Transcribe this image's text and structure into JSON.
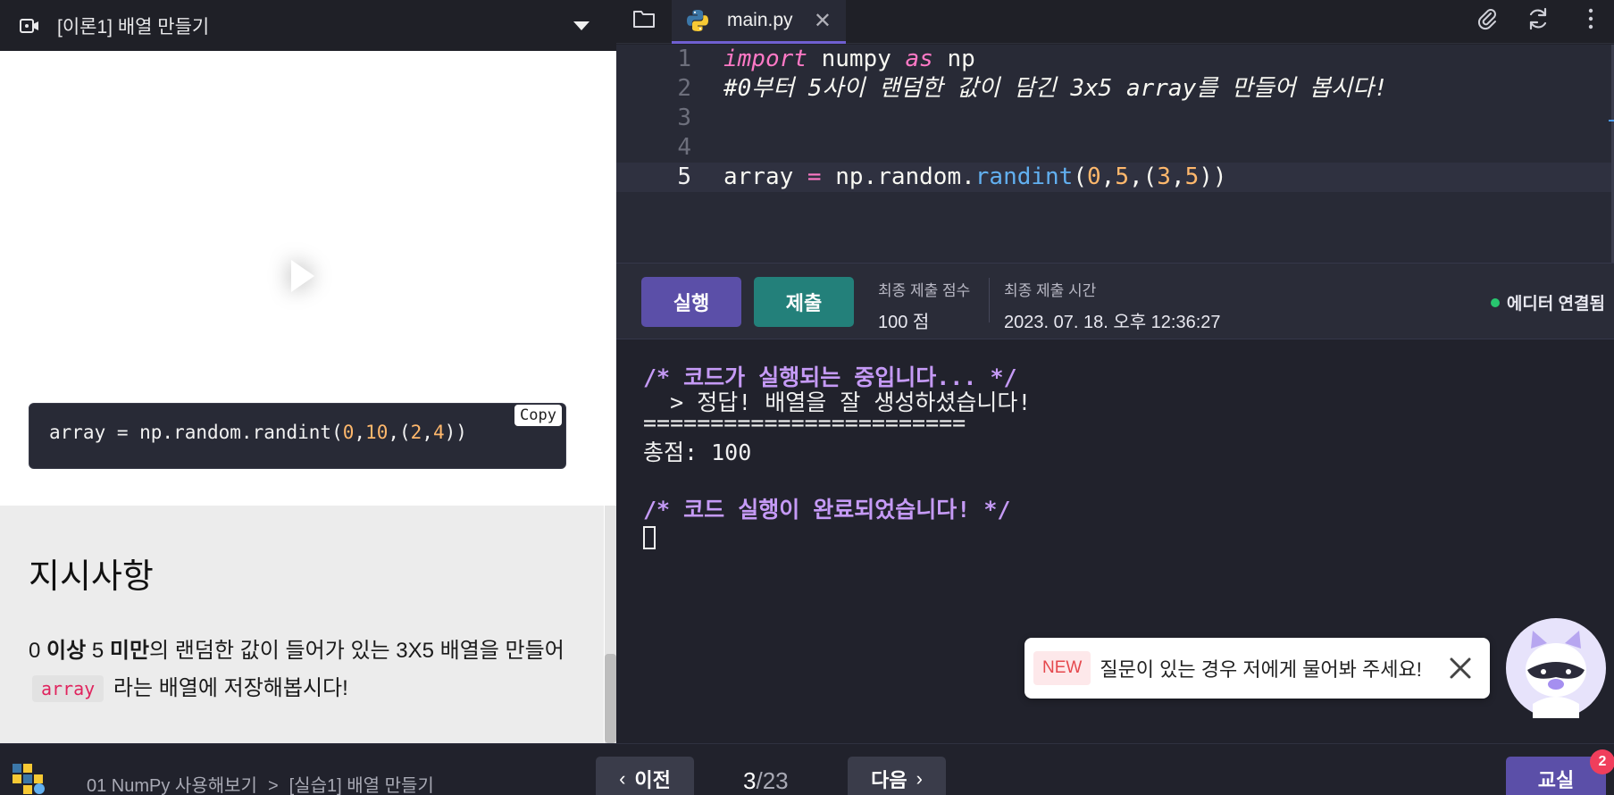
{
  "lesson": {
    "title": "[이론1] 배열 만들기"
  },
  "code_example": {
    "prefix": "array = np.random.randint(",
    "n1": "0",
    "c1": ",",
    "n2": "10",
    "c2": ",(",
    "n3": "2",
    "c3": ",",
    "n4": "4",
    "suffix": "))",
    "copy_label": "Copy"
  },
  "instructions": {
    "heading": "지시사항",
    "p1": "0 ",
    "b1": "이상",
    "p2": " 5 ",
    "b2": "미만",
    "p3": "의 랜덤한 값이 들어가 있는 3X5 배열을 만들어 ",
    "code": "array",
    "p4": " 라는 배열에 저장해봅시다!"
  },
  "editor": {
    "tab_name": "main.py",
    "lines": [
      {
        "n": "1"
      },
      {
        "n": "2",
        "text": "#0부터 5사이 랜덤한 값이 담긴 3x5 array를 만들어 봅시다!"
      },
      {
        "n": "3"
      },
      {
        "n": "4"
      },
      {
        "n": "5"
      }
    ],
    "l1": {
      "kw1": "import",
      "t1": " numpy ",
      "kw2": "as",
      "t2": " np"
    },
    "l5": {
      "t1": "array ",
      "op": "=",
      "t2": " np.random.",
      "fn": "randint",
      "t3": "(",
      "n1": "0",
      "c1": ",",
      "n2": "5",
      "c2": ",(",
      "n3": "3",
      "c3": ",",
      "n4": "5",
      "t4": "))"
    }
  },
  "runbar": {
    "run_label": "실행",
    "submit_label": "제출",
    "score_label": "최종 제출 점수",
    "score_value": "100 점",
    "time_label": "최종 제출 시간",
    "time_value": "2023. 07. 18. 오후 12:36:27",
    "connection": "에디터 연결됨",
    "connection_color": "#28c76f"
  },
  "console": {
    "lines": [
      "/* 코드가 실행되는 중입니다... */",
      "  > 정답! 배열을 잘 생성하셨습니다!",
      "========================",
      "총점: 100",
      "/* 코드 실행이 완료되었습니다! */"
    ]
  },
  "chat": {
    "new_label": "NEW",
    "message": "질문이 있는 경우 저에게 물어봐 주세요!"
  },
  "bottom": {
    "crumb_course": "01 NumPy 사용해보기",
    "crumb_sep": ">",
    "crumb_lesson": "[실습1] 배열 만들기",
    "prev_label": "이전",
    "next_label": "다음",
    "page_current": "3",
    "page_total": "/23",
    "class_label": "교실",
    "badge_count": "2"
  },
  "colors": {
    "accent": "#5b4fa8",
    "submit": "#23807a",
    "keyword": "#ff79c6",
    "number": "#ffb86c",
    "function": "#62b0f0",
    "console_info": "#c59af6"
  }
}
